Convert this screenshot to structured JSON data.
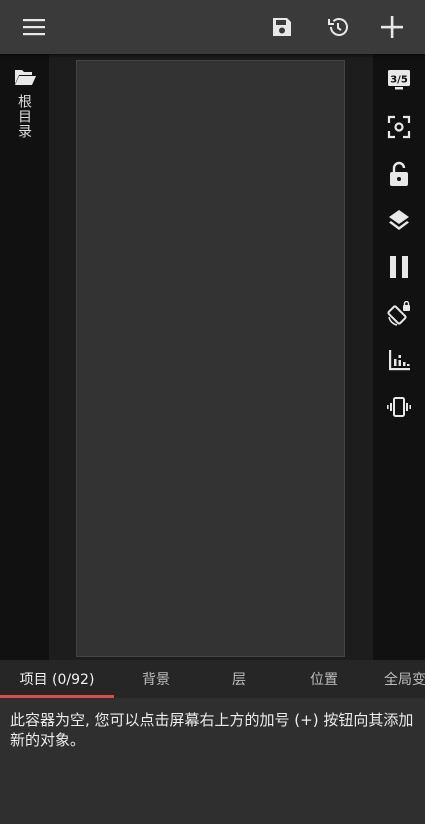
{
  "toolbar": {
    "menu_icon": "hamburger-menu-icon",
    "save_icon": "floppy-disk-icon",
    "history_icon": "history-icon",
    "add_icon": "plus-icon"
  },
  "left_panel": {
    "folder_icon": "folder-open-icon",
    "root_label": "根目录"
  },
  "right_panel": {
    "scene_counter": "3/5",
    "tools": [
      "focus-capture-icon",
      "unlock-icon",
      "layers-icon",
      "pause-icon",
      "rotate-lock-icon",
      "equalizer-icon",
      "vibrate-icon"
    ]
  },
  "tabs": [
    {
      "label": "项目 (0/92)",
      "active": true
    },
    {
      "label": "背景",
      "active": false
    },
    {
      "label": "层",
      "active": false
    },
    {
      "label": "位置",
      "active": false
    },
    {
      "label": "全局变",
      "active": false
    }
  ],
  "content": {
    "empty_message": "此容器为空, 您可以点击屏幕右上方的加号 (+) 按钮向其添加新的对象。"
  },
  "colors": {
    "topbar": "#3a3a3a",
    "panel": "#111111",
    "canvas": "#333333",
    "accent": "#d84c4c"
  }
}
